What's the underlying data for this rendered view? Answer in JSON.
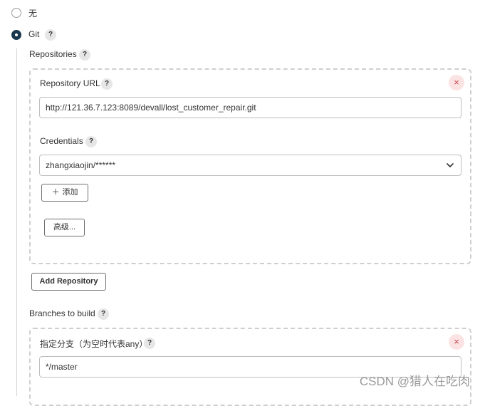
{
  "scm": {
    "none_label": "无",
    "git_label": "Git",
    "help_glyph": "?"
  },
  "repositories": {
    "section_label": "Repositories",
    "url_label": "Repository URL",
    "url_value": "http://121.36.7.123:8089/devall/lost_customer_repair.git",
    "credentials_label": "Credentials",
    "credentials_value": "zhangxiaojin/******",
    "add_button_icon": "＋",
    "add_button_label": "添加",
    "advanced_button_label": "高级...",
    "add_repository_label": "Add Repository",
    "remove_glyph": "×"
  },
  "branches": {
    "section_label": "Branches to build",
    "branch_label": "指定分支（为空时代表any）",
    "branch_value": "*/master",
    "remove_glyph": "×"
  },
  "watermark": "CSDN @猎人在吃肉",
  "colors": {
    "radio_checked": "#18374e",
    "remove_bg": "#fbe3e3",
    "remove_fg": "#d0454c"
  }
}
